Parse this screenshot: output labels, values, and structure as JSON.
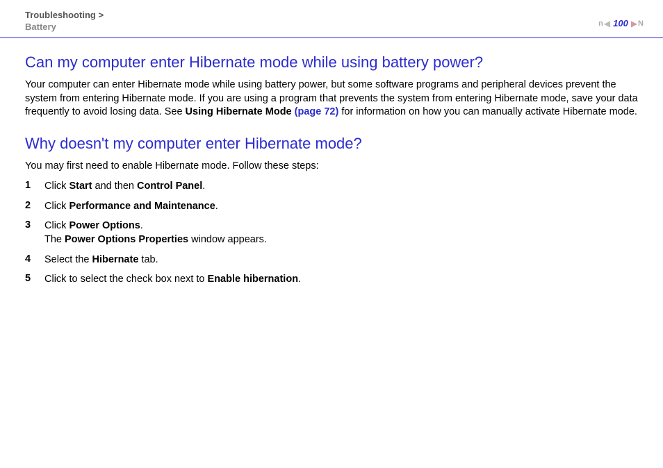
{
  "breadcrumb": {
    "line1_pre": "Troubleshooting",
    "line1_sep": " > ",
    "line2": "Battery"
  },
  "pager": {
    "page": "100",
    "n_left": "n",
    "n_right": "N"
  },
  "q1": {
    "heading": "Can my computer enter Hibernate mode while using battery power?",
    "para_pre": "Your computer can enter Hibernate mode while using battery power, but some software programs and peripheral devices prevent the system from entering Hibernate mode. If you are using a program that prevents the system from entering Hibernate mode, save your data frequently to avoid losing data. See ",
    "bold1": "Using Hibernate Mode ",
    "link": "(page 72)",
    "para_post": " for information on how you can manually activate Hibernate mode."
  },
  "q2": {
    "heading": "Why doesn't my computer enter Hibernate mode?",
    "intro": "You may first need to enable Hibernate mode. Follow these steps:",
    "steps": {
      "s1": {
        "num": "1",
        "pre": "Click ",
        "b1": "Start",
        "mid": " and then ",
        "b2": "Control Panel",
        "post": "."
      },
      "s2": {
        "num": "2",
        "pre": "Click ",
        "b1": "Performance and Maintenance",
        "post": "."
      },
      "s3": {
        "num": "3",
        "pre": "Click ",
        "b1": "Power Options",
        "post1": ".",
        "line2_pre": "The ",
        "line2_b": "Power Options Properties",
        "line2_post": " window appears."
      },
      "s4": {
        "num": "4",
        "pre": "Select the ",
        "b1": "Hibernate",
        "post": " tab."
      },
      "s5": {
        "num": "5",
        "pre": "Click to select the check box next to ",
        "b1": "Enable hibernation",
        "post": "."
      }
    }
  }
}
